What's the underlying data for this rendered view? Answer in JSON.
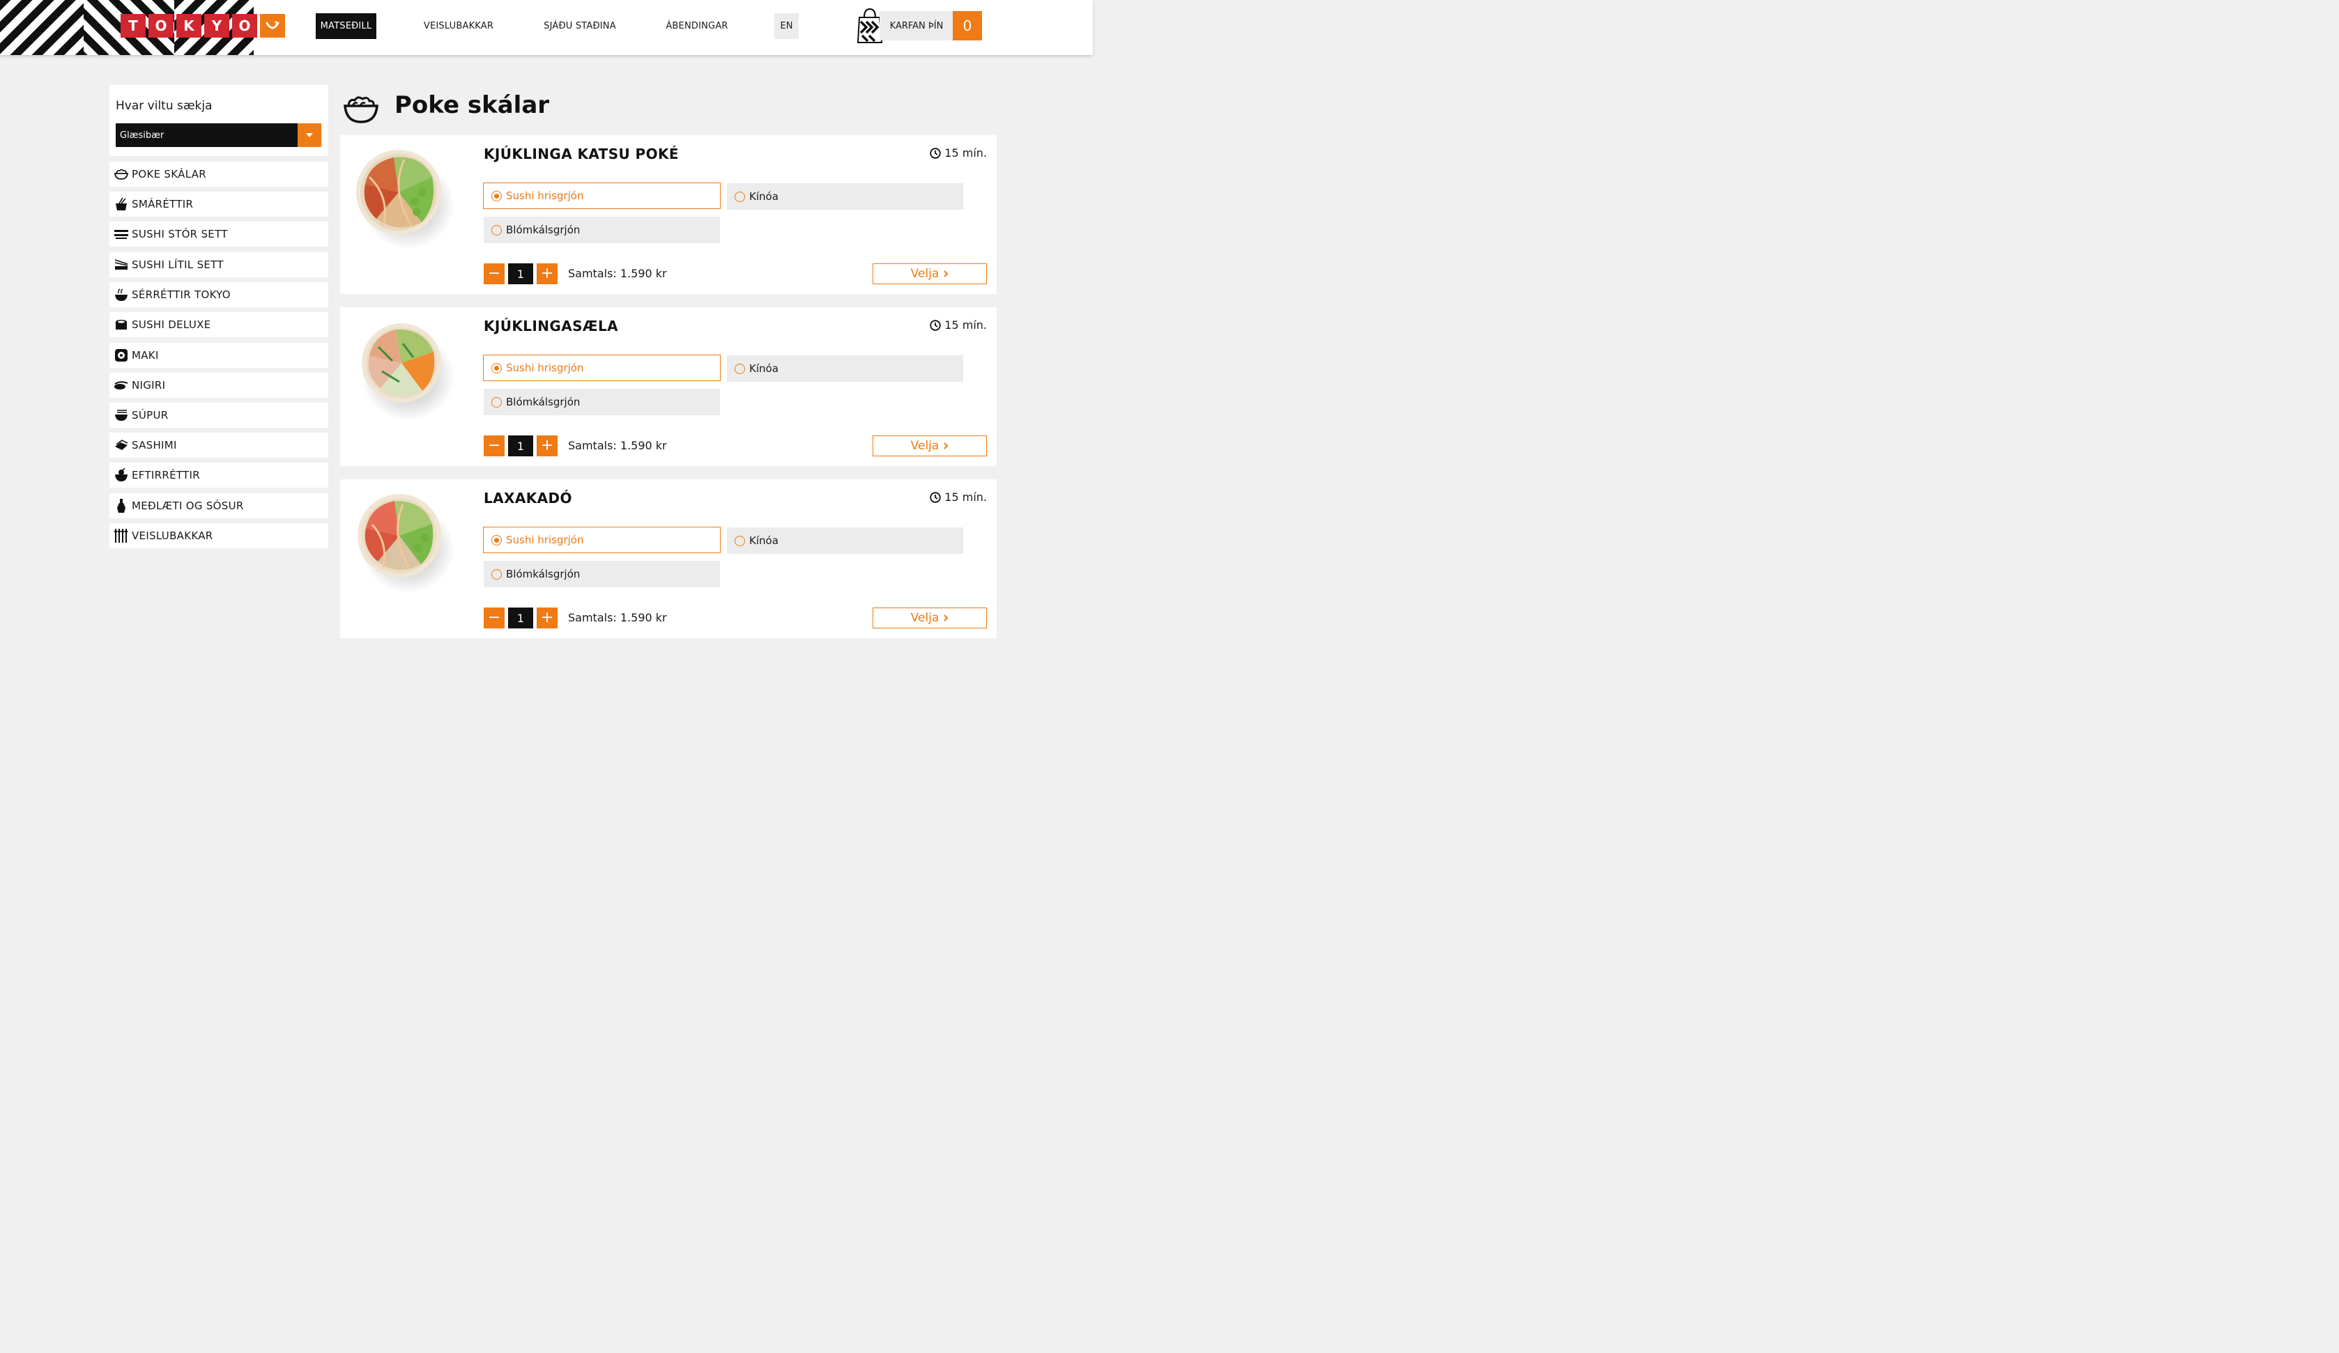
{
  "header": {
    "logo_letters": [
      "T",
      "O",
      "K",
      "Y",
      "O"
    ],
    "nav": {
      "menu": "MATSEÐILL",
      "platters": "VEISLUBAKKAR",
      "locations": "SJÁÐU STAÐINA",
      "feedback": "ÁBENDINGAR"
    },
    "lang": "EN",
    "cart_label": "KARFAN ÞÍN",
    "cart_count": "0"
  },
  "location": {
    "label": "Hvar viltu sækja",
    "selected": "Glæsibær"
  },
  "categories": [
    {
      "label": "POKE SKÁLAR",
      "icon": "bowl-icon"
    },
    {
      "label": "SMÁRÉTTIR",
      "icon": "small-dish-icon"
    },
    {
      "label": "SUSHI STÓR SETT",
      "icon": "sushi-boat-icon"
    },
    {
      "label": "SUSHI LÍTIL SETT",
      "icon": "sushi-small-set-icon"
    },
    {
      "label": "SÉRRÉTTIR TOKYO",
      "icon": "special-dish-icon"
    },
    {
      "label": "SUSHI DELUXE",
      "icon": "sushi-deluxe-icon"
    },
    {
      "label": "MAKI",
      "icon": "maki-icon"
    },
    {
      "label": "NIGIRI",
      "icon": "nigiri-icon"
    },
    {
      "label": "SÚPUR",
      "icon": "soup-icon"
    },
    {
      "label": "SASHIMI",
      "icon": "sashimi-icon"
    },
    {
      "label": "EFTIRRÉTTIR",
      "icon": "dessert-icon"
    },
    {
      "label": "MEÐLÆTI OG SÓSUR",
      "icon": "sauce-bottle-icon"
    },
    {
      "label": "VEISLUBAKKAR",
      "icon": "platter-icon"
    }
  ],
  "page": {
    "title": "Poke skálar"
  },
  "products": [
    {
      "name": "KJÚKLINGA KATSU POKÉ",
      "time": "15 mín.",
      "options": [
        "Sushi hrisgrjón",
        "Kínóa",
        "Blómkálsgrjón"
      ],
      "selected_option": "Sushi hrisgrjón",
      "quantity": "1",
      "total": "Samtals: 1.590 kr",
      "button": "Velja"
    },
    {
      "name": "KJÚKLINGASÆLA",
      "time": "15 mín.",
      "options": [
        "Sushi hrisgrjón",
        "Kínóa",
        "Blómkálsgrjón"
      ],
      "selected_option": "Sushi hrisgrjón",
      "quantity": "1",
      "total": "Samtals: 1.590 kr",
      "button": "Velja"
    },
    {
      "name": "LAXAKADÓ",
      "time": "15 mín.",
      "options": [
        "Sushi hrisgrjón",
        "Kínóa",
        "Blómkálsgrjón"
      ],
      "selected_option": "Sushi hrisgrjón",
      "quantity": "1",
      "total": "Samtals: 1.590 kr",
      "button": "Velja"
    }
  ],
  "colors": {
    "accent": "#f07a14",
    "logo_red": "#d22630",
    "dark": "#111111",
    "background": "#f0f0f0"
  }
}
